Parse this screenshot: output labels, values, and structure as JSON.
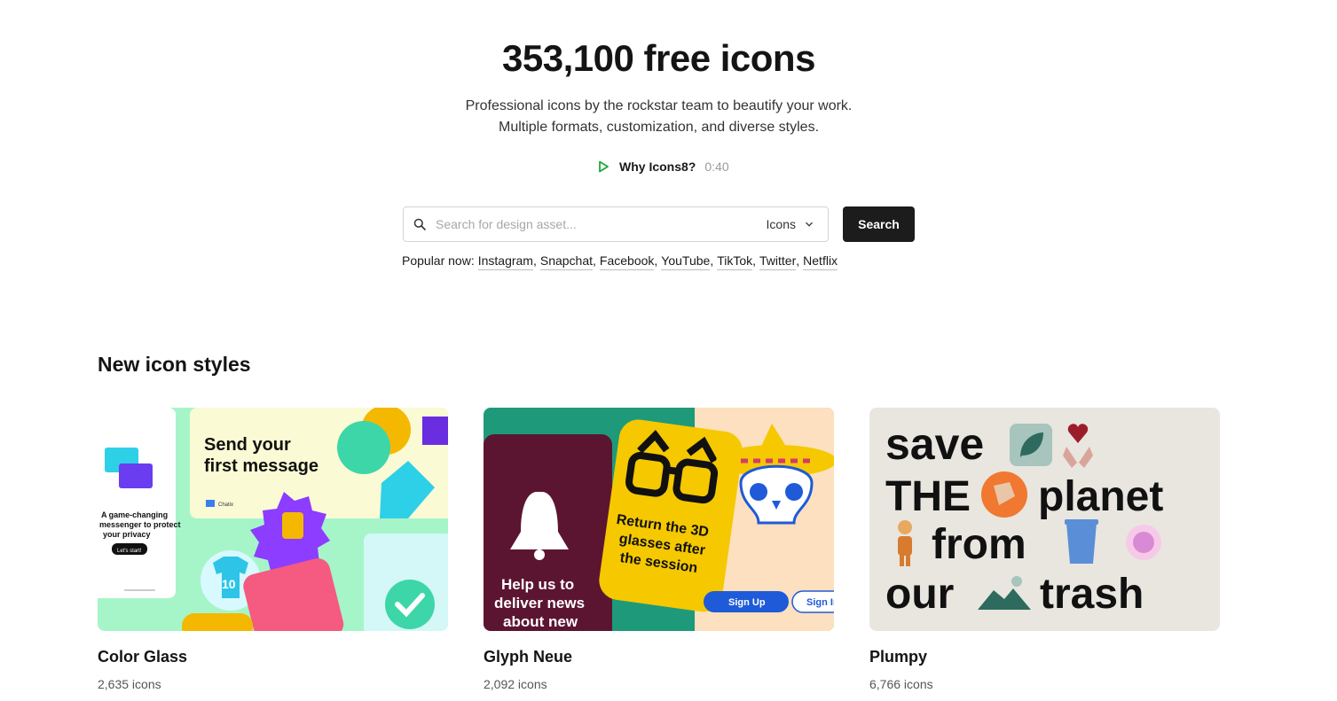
{
  "hero": {
    "title": "353,100 free icons",
    "subtitle_line1": "Professional icons by the rockstar team to beautify your work.",
    "subtitle_line2": "Multiple formats, customization, and diverse styles.",
    "why_label": "Why Icons8?",
    "why_time": "0:40",
    "play_icon": "play-icon",
    "play_color": "#1fa83c"
  },
  "search": {
    "placeholder": "Search for design asset...",
    "value": "",
    "type_selected": "Icons",
    "button_label": "Search"
  },
  "popular": {
    "label": "Popular now:",
    "items": [
      "Instagram",
      "Snapchat",
      "Facebook",
      "YouTube",
      "TikTok",
      "Twitter",
      "Netflix"
    ]
  },
  "section": {
    "title": "New icon styles"
  },
  "cards": [
    {
      "name": "Color Glass",
      "count": "2,635 icons",
      "art_texts": [
        "Send your",
        "first message",
        "A game-changing",
        "messenger to protect",
        "your privacy",
        "Let's start!",
        "Chatix",
        "10"
      ]
    },
    {
      "name": "Glyph Neue",
      "count": "2,092 icons",
      "art_texts": [
        "Return the 3D",
        "glasses after",
        "the session",
        "Help us to",
        "deliver news",
        "about new",
        "Sign Up",
        "Sign In"
      ]
    },
    {
      "name": "Plumpy",
      "count": "6,766 icons",
      "art_texts": [
        "save",
        "THE",
        "planet",
        "from",
        "our",
        "trash"
      ]
    }
  ],
  "colors": {
    "dark_button": "#1c1c1c",
    "color_glass_bg": "#a6f5c9",
    "glyph_teal": "#1e9a7a",
    "glyph_maroon": "#5c1530",
    "glyph_yellow": "#f5c800",
    "plumpy_bg": "#e8e6df"
  }
}
